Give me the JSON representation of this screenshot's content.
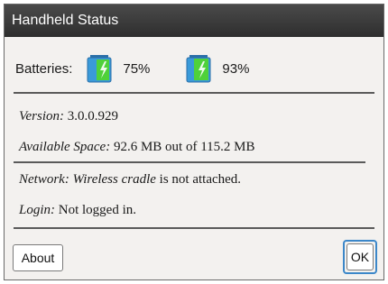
{
  "window": {
    "title": "Handheld Status"
  },
  "batteries": {
    "label": "Batteries:",
    "items": [
      {
        "percent": "75%",
        "icon": "battery-charging-icon"
      },
      {
        "percent": "93%",
        "icon": "battery-charging-icon"
      }
    ]
  },
  "info": {
    "version_label": "Version:",
    "version_value": "3.0.0.929",
    "space_label": "Available Space:",
    "space_value": "92.6 MB out of 115.2 MB",
    "network_label": "Network:",
    "network_em": "Wireless cradle",
    "network_value": "is not attached.",
    "login_label": "Login:",
    "login_value": "Not logged in."
  },
  "buttons": {
    "about": "About",
    "ok": "OK"
  },
  "colors": {
    "battery_body": "#3a9ad9",
    "battery_charge": "#4fd13a",
    "ok_focus": "#3c87c9"
  }
}
